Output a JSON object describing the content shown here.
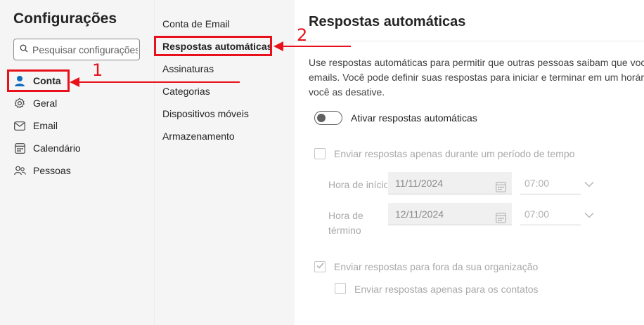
{
  "sidebar": {
    "title": "Configurações",
    "search_placeholder": "Pesquisar configurações",
    "items": [
      {
        "label": "Conta",
        "icon": "person-icon",
        "active": true
      },
      {
        "label": "Geral",
        "icon": "gear-icon"
      },
      {
        "label": "Email",
        "icon": "mail-icon"
      },
      {
        "label": "Calendário",
        "icon": "calendar-icon"
      },
      {
        "label": "Pessoas",
        "icon": "people-icon"
      }
    ]
  },
  "submenu": {
    "items": [
      {
        "label": "Conta de Email"
      },
      {
        "label": "Respostas automáticas",
        "active": true
      },
      {
        "label": "Assinaturas"
      },
      {
        "label": "Categorias"
      },
      {
        "label": "Dispositivos móveis"
      },
      {
        "label": "Armazenamento"
      }
    ]
  },
  "annotations": {
    "callout_1": "1",
    "callout_2": "2",
    "highlight_color": "#e8101a"
  },
  "main": {
    "title": "Respostas automáticas",
    "description_lines": [
      "Use respostas automáticas para permitir que outras pessoas saibam que você",
      "emails. Você pode definir suas respostas para iniciar e terminar em um horário",
      "você as desative."
    ],
    "toggle_label": "Ativar respostas automáticas",
    "toggle_on": false,
    "period_checkbox_label": "Enviar respostas apenas durante um período de tempo",
    "start_label": "Hora de início",
    "start_date": "11/11/2024",
    "start_time": "07:00",
    "end_label_line1": "Hora de",
    "end_label_line2": "término",
    "end_date": "12/11/2024",
    "end_time": "07:00",
    "outside_checkbox_label": "Enviar respostas para fora da sua organização",
    "outside_checked": true,
    "contacts_checkbox_label": "Enviar respostas apenas para os contatos",
    "contacts_checked": false
  },
  "colors": {
    "accent": "#0f6cbd",
    "sidebar_bg": "#f5f5f5"
  }
}
